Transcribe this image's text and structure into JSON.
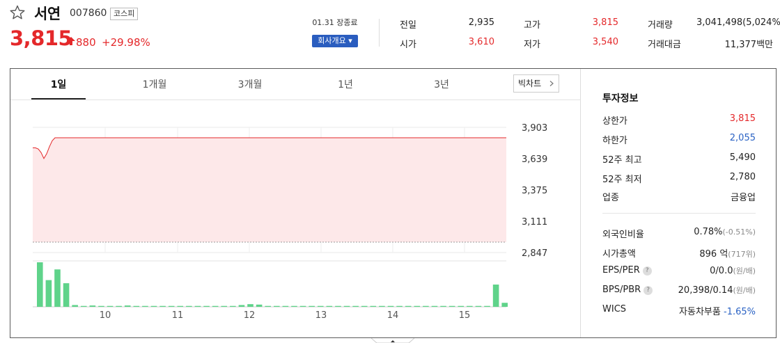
{
  "stock": {
    "name": "서연",
    "code": "007860",
    "market": "코스피",
    "price": "3,815",
    "change": "880",
    "change_rate": "+29.98%",
    "market_time": "01.31 장종료",
    "overview_button": "회사개요 ▾"
  },
  "stats": [
    {
      "label": "전일",
      "value": "2,935",
      "color": "#222222"
    },
    {
      "label": "시가",
      "value": "3,610",
      "color": "#e4282a"
    },
    {
      "label": "고가",
      "value": "3,815",
      "color": "#e4282a"
    },
    {
      "label": "저가",
      "value": "3,540",
      "color": "#e4282a"
    },
    {
      "label": "거래량",
      "value": "3,041,498(5,024%)",
      "color": "#222222"
    },
    {
      "label": "거래대금",
      "value": "11,377백만",
      "color": "#222222"
    }
  ],
  "tabs": [
    "1일",
    "1개월",
    "3개월",
    "1년",
    "3년"
  ],
  "active_tab": "1일",
  "big_chart_button": "빅차트",
  "chart_data": {
    "type": "area",
    "y_ticks": [
      "3,903",
      "3,639",
      "3,375",
      "3,111",
      "2,847"
    ],
    "x_ticks": [
      "10",
      "11",
      "12",
      "13",
      "14",
      "15"
    ],
    "ylim": [
      2847,
      3903
    ],
    "base_line": 2935,
    "price_series": [
      3730,
      3730,
      3720,
      3690,
      3640,
      3680,
      3740,
      3790,
      3815,
      3815,
      3815,
      3815,
      3815,
      3815,
      3815,
      3815,
      3815,
      3815,
      3815,
      3815
    ],
    "volume_bars": [
      1.0,
      0.6,
      0.84,
      0.53,
      0.04,
      0.02,
      0.03,
      0.02,
      0.02,
      0.02,
      0.03,
      0.02,
      0.02,
      0.02,
      0.02,
      0.02,
      0.02,
      0.02,
      0.02,
      0.02,
      0.02,
      0.02,
      0.02,
      0.04,
      0.06,
      0.05,
      0.02,
      0.02,
      0.02,
      0.02,
      0.02,
      0.02,
      0.02,
      0.02,
      0.02,
      0.02,
      0.02,
      0.02,
      0.02,
      0.02,
      0.02,
      0.02,
      0.02,
      0.02,
      0.02,
      0.02,
      0.02,
      0.02,
      0.02,
      0.02,
      0.02,
      0.02,
      0.5,
      0.09
    ],
    "colors": {
      "line": "#e4282a",
      "fill": "#fde8e9",
      "volume": "#5fd38a"
    }
  },
  "invest": {
    "title": "투자정보",
    "rows1": [
      {
        "label": "상한가",
        "value": "3,815",
        "color": "#e4282a"
      },
      {
        "label": "하한가",
        "value": "2,055",
        "color": "#2a62c4"
      },
      {
        "label": "52주 최고",
        "value": "5,490",
        "color": "#222222"
      },
      {
        "label": "52주 최저",
        "value": "2,780",
        "color": "#222222"
      },
      {
        "label": "업종",
        "value": "금융업",
        "color": "#222222"
      }
    ],
    "foreign_label": "외국인비율",
    "foreign_value": "0.78%",
    "foreign_sub": "(-0.51%)",
    "cap_label": "시가총액",
    "cap_value": "896 억",
    "cap_sub": "(717위)",
    "eps_label": "EPS/PER",
    "eps_value": "0/0.0",
    "eps_sub": "(원/배)",
    "bps_label": "BPS/PBR",
    "bps_value": "20,398/0.14",
    "bps_sub": "(원/배)",
    "wics_label": "WICS",
    "wics_value": "자동차부품",
    "wics_change": "-1.65%"
  }
}
